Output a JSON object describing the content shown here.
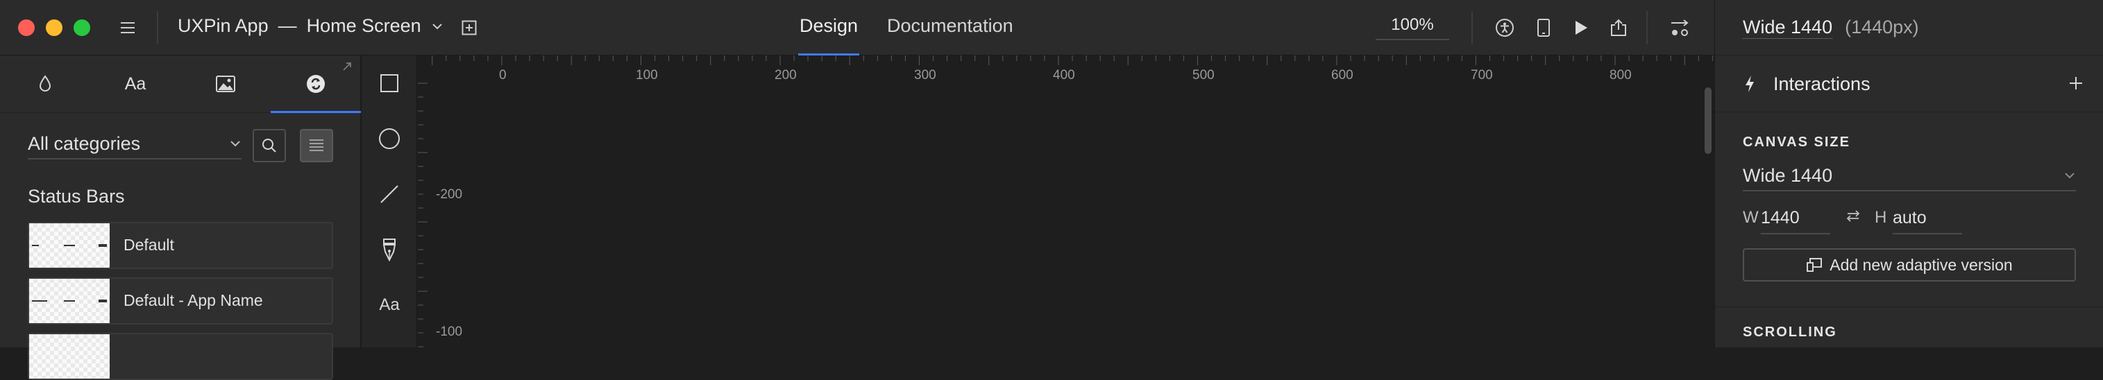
{
  "topbar": {
    "project_name": "UXPin App",
    "separator": "—",
    "screen_name": "Home Screen",
    "tabs": [
      {
        "label": "Design",
        "active": true
      },
      {
        "label": "Documentation",
        "active": false
      }
    ],
    "zoom": "100%",
    "icons": [
      "menu-icon",
      "add-page-icon",
      "accessibility-icon",
      "device-preview-icon",
      "play-icon",
      "share-icon",
      "settings-sliders-icon"
    ]
  },
  "left_panel": {
    "tabs": [
      {
        "icon": "color-drop-icon"
      },
      {
        "label": "Aa"
      },
      {
        "icon": "image-icon"
      },
      {
        "icon": "design-system-icon",
        "active": true
      }
    ],
    "category_select": "All categories",
    "section_title": "Status Bars",
    "items": [
      {
        "label": "Default"
      },
      {
        "label": "Default - App Name"
      },
      {
        "label": ""
      }
    ]
  },
  "tools": {
    "items": [
      "rectangle-tool-icon",
      "ellipse-tool-icon",
      "line-tool-icon",
      "pen-tool-icon"
    ],
    "text_tool_label": "Aa"
  },
  "canvas": {
    "ruler_x_labels": [
      "0",
      "100",
      "200",
      "300",
      "400",
      "500",
      "600",
      "700",
      "800"
    ],
    "ruler_y_labels": [
      "-200",
      "-100"
    ]
  },
  "right_panel": {
    "breakpoint_name": "Wide 1440",
    "breakpoint_size": "(1440px)",
    "interactions_label": "Interactions",
    "canvas_size_heading": "CANVAS SIZE",
    "canvas_size_value": "Wide 1440",
    "width_label": "W",
    "width_value": "1440",
    "height_label": "H",
    "height_value": "auto",
    "add_adaptive_label": "Add new adaptive version",
    "scrolling_heading": "SCROLLING"
  },
  "colors": {
    "accent": "#3e7bfa",
    "panel_bg": "#2b2b2b",
    "canvas_bg": "#1e1e1e",
    "close": "#ff5f57",
    "minimize": "#febc2e",
    "maximize": "#28c840"
  }
}
